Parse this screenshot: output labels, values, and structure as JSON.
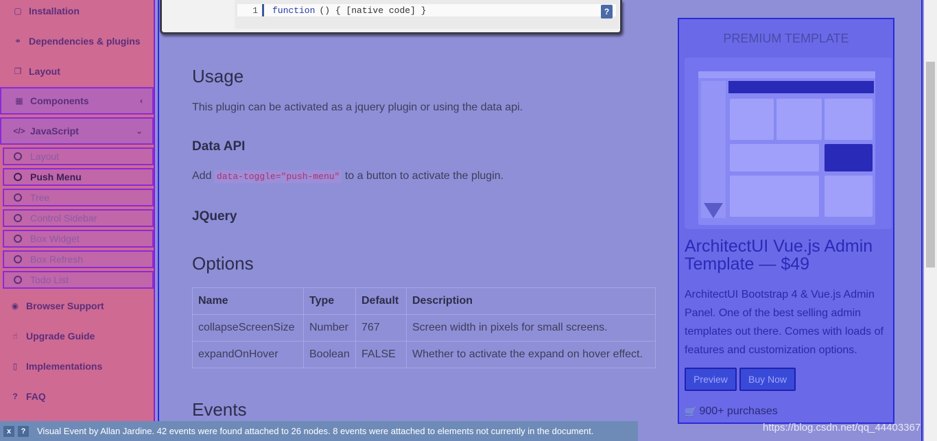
{
  "sidebar": {
    "items_top": [
      {
        "label": "Installation",
        "icon": "db-icon"
      },
      {
        "label": "Dependencies & plugins",
        "icon": "handshake-icon"
      },
      {
        "label": "Layout",
        "icon": "copy-icon"
      }
    ],
    "components": {
      "label": "Components",
      "icon": "grid-icon",
      "chevron": "‹"
    },
    "javascript": {
      "label": "JavaScript",
      "icon": "code-icon",
      "chevron": "⌄"
    },
    "sub_items": [
      "Layout",
      "Push Menu",
      "Tree",
      "Control Sidebar",
      "Box Widget",
      "Box Refresh",
      "Todo List"
    ],
    "active_sub": "Push Menu",
    "items_bottom": [
      {
        "label": "Browser Support",
        "icon": "chrome-icon"
      },
      {
        "label": "Upgrade Guide",
        "icon": "hand-icon"
      },
      {
        "label": "Implementations",
        "icon": "bookmark-icon"
      },
      {
        "label": "FAQ",
        "icon": "question-icon"
      }
    ]
  },
  "code": {
    "line_no": "1",
    "keyword": "function",
    "rest": "() { [native code] }",
    "help_label": "?"
  },
  "content": {
    "usage_heading": "Usage",
    "usage_text": "This plugin can be activated as a jquery plugin or using the data api.",
    "data_api_heading": "Data API",
    "data_api_prefix": "Add",
    "data_api_code": "data-toggle=\"push-menu\"",
    "data_api_suffix": "to a button to activate the plugin.",
    "jquery_heading": "JQuery",
    "options_heading": "Options",
    "events_heading": "Events"
  },
  "options_table": {
    "headers": [
      "Name",
      "Type",
      "Default",
      "Description"
    ],
    "rows": [
      [
        "collapseScreenSize",
        "Number",
        "767",
        "Screen width in pixels for small screens."
      ],
      [
        "expandOnHover",
        "Boolean",
        "FALSE",
        "Whether to activate the expand on hover effect."
      ]
    ]
  },
  "ad": {
    "header": "PREMIUM TEMPLATE",
    "title": "ArchitectUI Vue.js Admin Template — $49",
    "description": "ArchitectUI Bootstrap 4 & Vue.js Admin Panel. One of the best selling admin templates out there. Comes with loads of features and customization options.",
    "preview_label": "Preview",
    "buy_label": "Buy Now",
    "purchases": "900+ purchases"
  },
  "visual_event": {
    "close_label": "x",
    "help_label": "?",
    "text": "Visual Event by Allan Jardine.  42 events were found attached to 26 nodes. 8 events were attached to elements not currently in the document."
  },
  "watermark": "https://blog.csdn.net/qq_44403367"
}
